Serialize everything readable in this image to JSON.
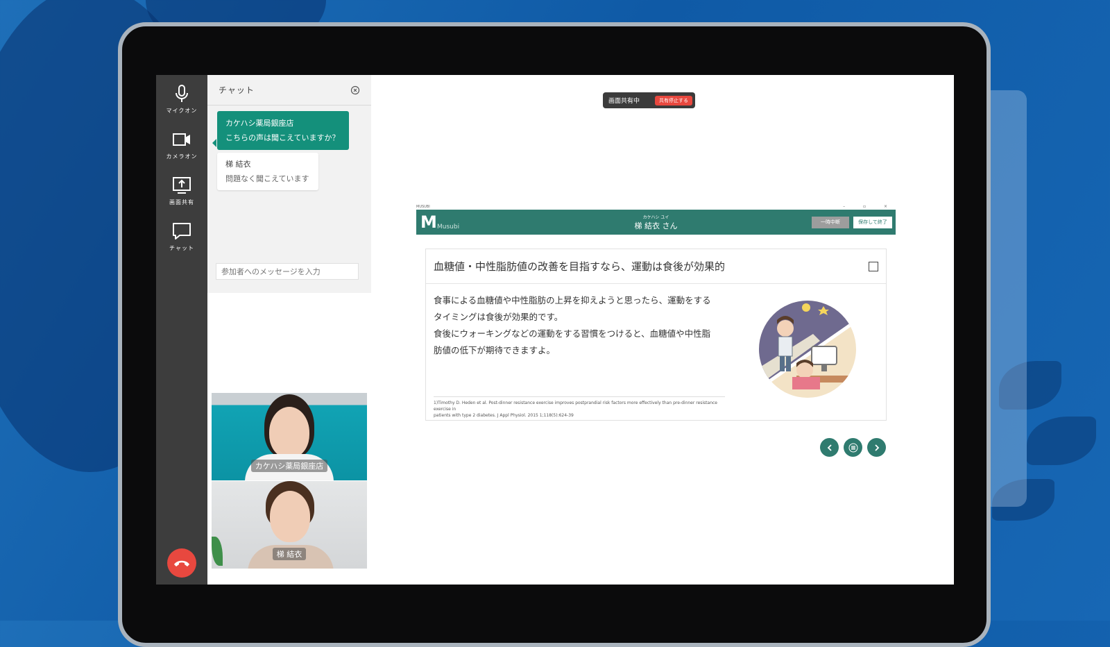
{
  "toolbar": {
    "mic_label": "マイクオン",
    "camera_label": "カメラオン",
    "share_label": "画面共有",
    "chat_label": "チャット"
  },
  "chat": {
    "title": "チャット",
    "messages": [
      {
        "sender": "カケハシ薬局銀座店",
        "text": "こちらの声は聞こえていますか？"
      },
      {
        "sender": "梯 結衣",
        "text": "問題なく聞こえています"
      }
    ],
    "input_placeholder": "参加者へのメッセージを入力"
  },
  "videos": [
    {
      "name": "カケハシ薬局銀座店"
    },
    {
      "name": "梯 結衣"
    }
  ],
  "share_bar": {
    "status": "画面共有中",
    "stop_label": "共有停止する"
  },
  "app": {
    "window_title": "MUSUBI",
    "logo_text": "M",
    "logo_sub": "Musubi",
    "patient_kana": "カケハシ ユイ",
    "patient_name": "梯 結衣 さん",
    "pause_label": "一時中断",
    "save_label": "保存して終了",
    "card_title": "血糖値・中性脂肪値の改善を目指すなら、運動は食後が効果的",
    "card_lines": [
      "食事による血糖値や中性脂肪の上昇を抑えようと思ったら、運動をする",
      "タイミングは食後が効果的です。",
      "食後にウォーキングなどの運動をする習慣をつけると、血糖値や中性脂",
      "肪値の低下が期待できますよ。"
    ],
    "reference_1": "1)Timothy D. Heden et al. Post-dinner resistance exercise improves postprandial risk factors more effectively than pre-dinner resistance exercise in",
    "reference_2": "patients with type 2 diabetes. J Appl Physiol. 2015 1;118(5):624-39"
  },
  "colors": {
    "accent": "#2f7b6f",
    "chat_bubble": "#14907b",
    "hangup": "#e8483f",
    "toolbar_bg": "#3d3d3d"
  },
  "icons": [
    "mic-icon",
    "video-camera-icon",
    "screen-share-icon",
    "chat-bubble-icon",
    "phone-hangup-icon",
    "close-icon",
    "chevron-left-icon",
    "menu-icon",
    "chevron-right-icon"
  ]
}
